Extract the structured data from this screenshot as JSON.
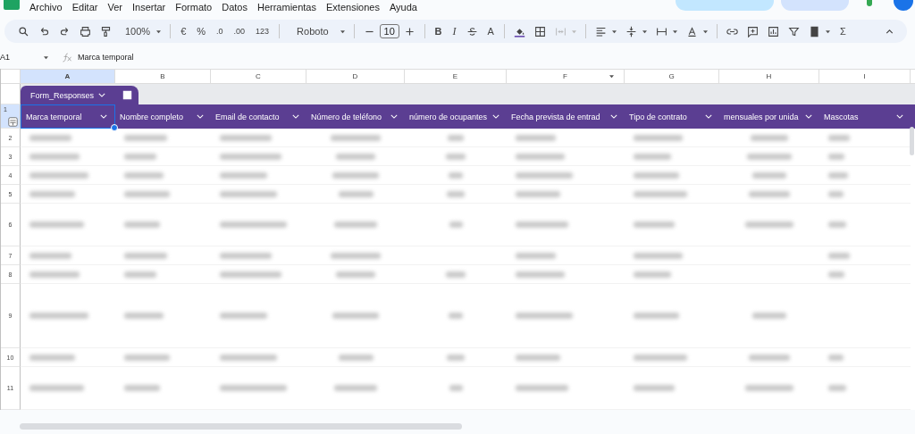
{
  "menu": [
    "Archivo",
    "Editar",
    "Ver",
    "Insertar",
    "Formato",
    "Datos",
    "Herramientas",
    "Extensiones",
    "Ayuda"
  ],
  "toolbar": {
    "zoom": "100%",
    "currency": "€",
    "percent": "%",
    "decrease_decimals": ".0",
    "increase_decimals": ".00",
    "number_format": "123",
    "font": "Roboto",
    "font_size": "10",
    "bold": "B",
    "italic": "I",
    "text_color": "A",
    "sum": "Σ"
  },
  "formula_bar": {
    "cell": "A1",
    "value": "Marca temporal"
  },
  "columns": [
    {
      "letter": "A",
      "selected": true,
      "filter": false
    },
    {
      "letter": "B",
      "selected": false,
      "filter": false
    },
    {
      "letter": "C",
      "selected": false,
      "filter": false
    },
    {
      "letter": "D",
      "selected": false,
      "filter": false
    },
    {
      "letter": "E",
      "selected": false,
      "filter": false
    },
    {
      "letter": "F",
      "selected": false,
      "filter": true
    },
    {
      "letter": "G",
      "selected": false,
      "filter": false
    },
    {
      "letter": "H",
      "selected": false,
      "filter": false
    },
    {
      "letter": "I",
      "selected": false,
      "filter": false
    }
  ],
  "table": {
    "name": "Form_Responses",
    "header_row": "1",
    "headers": [
      "Marca temporal",
      "Nombre completo",
      "Email de contacto",
      "Número de teléfono",
      "número de ocupantes",
      "Fecha prevista de entrad",
      "Tipo de contrato",
      "mensuales por unida",
      "Mascotas"
    ]
  },
  "rows": [
    {
      "number": "2",
      "kind": "normal",
      "filled": [
        true,
        true,
        true,
        true,
        true,
        true,
        true,
        true,
        true
      ]
    },
    {
      "number": "3",
      "kind": "normal",
      "filled": [
        true,
        true,
        true,
        true,
        true,
        true,
        true,
        true,
        true
      ]
    },
    {
      "number": "4",
      "kind": "normal",
      "filled": [
        true,
        true,
        true,
        true,
        true,
        true,
        true,
        true,
        true
      ]
    },
    {
      "number": "5",
      "kind": "normal",
      "filled": [
        true,
        true,
        true,
        true,
        true,
        true,
        true,
        true,
        true
      ]
    },
    {
      "number": "6",
      "kind": "tall",
      "filled": [
        true,
        true,
        true,
        true,
        true,
        true,
        true,
        true,
        true
      ]
    },
    {
      "number": "7",
      "kind": "normal",
      "filled": [
        true,
        true,
        true,
        true,
        false,
        true,
        true,
        false,
        true
      ]
    },
    {
      "number": "8",
      "kind": "normal",
      "filled": [
        true,
        true,
        true,
        true,
        true,
        true,
        true,
        false,
        true
      ]
    },
    {
      "number": "9",
      "kind": "extra_tall",
      "filled": [
        true,
        true,
        true,
        true,
        true,
        true,
        true,
        true,
        false
      ]
    },
    {
      "number": "10",
      "kind": "normal",
      "filled": [
        true,
        true,
        true,
        true,
        true,
        true,
        true,
        true,
        true
      ]
    },
    {
      "number": "11",
      "kind": "tall",
      "filled": [
        true,
        true,
        true,
        true,
        true,
        true,
        true,
        true,
        true
      ]
    }
  ]
}
